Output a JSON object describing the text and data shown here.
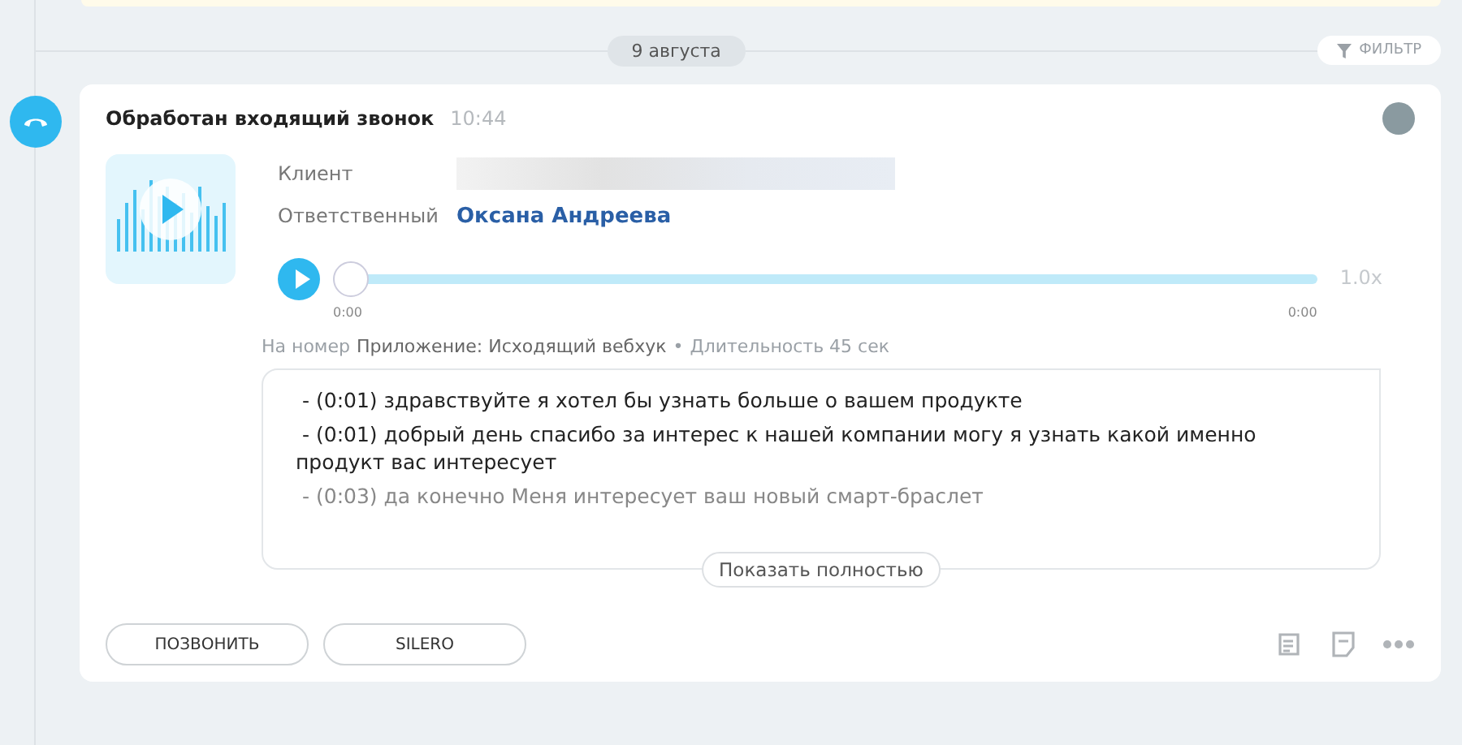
{
  "date_divider": {
    "label": "9 августа"
  },
  "filter_button": {
    "label": "ФИЛЬТР"
  },
  "event": {
    "title": "Обработан входящий звонок",
    "time": "10:44",
    "fields": [
      {
        "kind": "redacted",
        "label": "Клиент"
      },
      {
        "kind": "link",
        "label": "Ответственный",
        "value": "Оксана Андреева"
      }
    ],
    "player": {
      "level": 0,
      "start_time": "0:00",
      "end_time": "0:00",
      "speed": "1.0x"
    },
    "meta": {
      "prefix": "На номер",
      "source": "Приложение: Исходящий вебхук",
      "separator": "•",
      "duration": "Длительность 45 сек"
    },
    "transcript": [
      {
        "text": "- (0:01) здравствуйте я хотел бы узнать больше о вашем продукте",
        "faded": false
      },
      {
        "text": "- (0:01) добрый день спасибо за интерес к нашей компании могу я узнать какой именно продукт вас интересует",
        "faded": false
      },
      {
        "text": "- (0:03) да конечно Меня интересует ваш новый смарт-браслет",
        "faded": true
      }
    ],
    "show_more": "Показать полностью",
    "buttons": [
      "ПОЗВОНИТЬ",
      "SILERO"
    ]
  }
}
